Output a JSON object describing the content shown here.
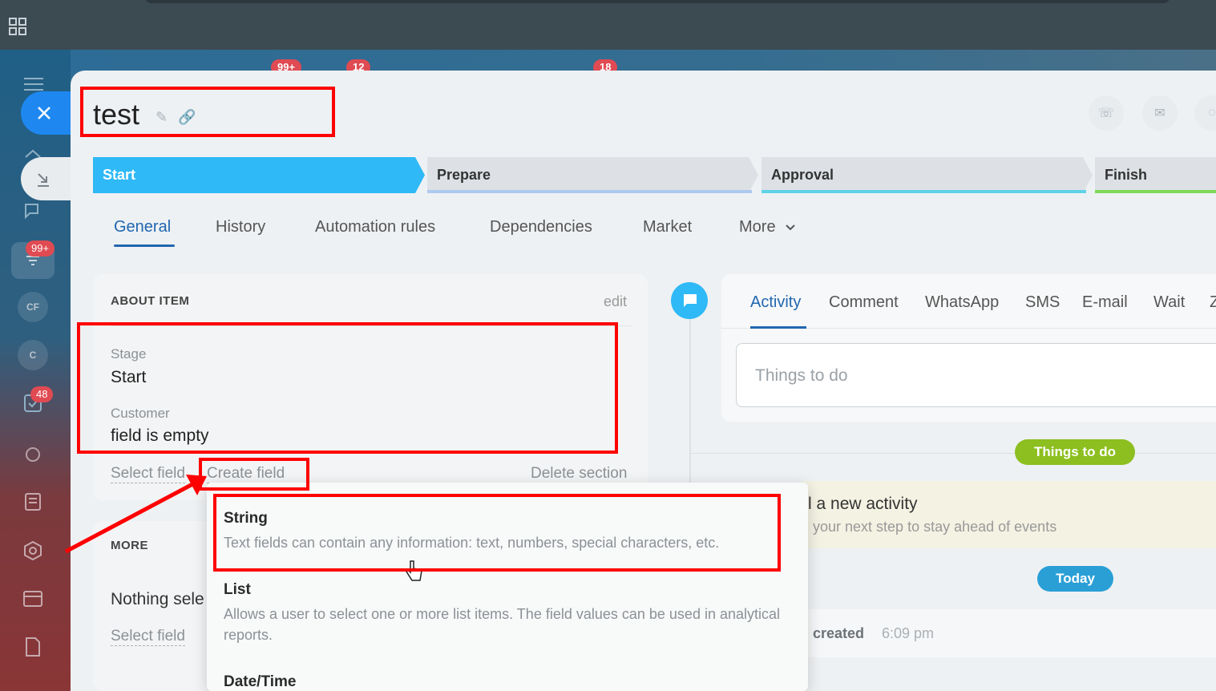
{
  "topbar": {
    "grid_icon": "grid-icon"
  },
  "badges_top": [
    "99+",
    "12",
    "18"
  ],
  "sidebar": {
    "close_icon": "close-icon",
    "minimize_icon": "minimize-icon",
    "badges": {
      "filter": "99+",
      "tasks": "48"
    },
    "avatars": {
      "cf": "CF",
      "c": "C"
    }
  },
  "item": {
    "title": "test",
    "stages": [
      "Start",
      "Prepare",
      "Approval",
      "Finish"
    ],
    "tabs": [
      "General",
      "History",
      "Automation rules",
      "Dependencies",
      "Market",
      "More"
    ]
  },
  "about": {
    "heading": "ABOUT ITEM",
    "edit": "edit",
    "fields": [
      {
        "label": "Stage",
        "value": "Start"
      },
      {
        "label": "Customer",
        "value": "field is empty"
      }
    ],
    "select_field": "Select field",
    "create_field": "Create field",
    "delete_section": "Delete section"
  },
  "more_section": {
    "heading": "MORE",
    "nothing": "Nothing sele",
    "select_field": "Select field"
  },
  "dropdown": {
    "items": [
      {
        "title": "String",
        "desc": "Text fields can contain any information: text, numbers, special characters, etc."
      },
      {
        "title": "List",
        "desc": "Allows a user to select one or more list items. The field values can be used in analytical reports."
      },
      {
        "title": "Date/Time",
        "desc": ""
      }
    ]
  },
  "activity": {
    "tabs": [
      "Activity",
      "Comment",
      "WhatsApp",
      "SMS",
      "E-mail",
      "Wait",
      "Z"
    ],
    "placeholder": "Things to do",
    "things_badge": "Things to do",
    "new_activity_title": "l a new activity",
    "new_activity_sub": "your next step to stay ahead of events",
    "today_badge": "Today",
    "created_label": "ı created",
    "created_time": "6:09 pm"
  },
  "colors": {
    "accent": "#2fb9f6",
    "link_blue": "#2067b0",
    "annotation_red": "#ff0000",
    "things_green": "#8cbf1f",
    "today_blue": "#2a9fd6"
  }
}
